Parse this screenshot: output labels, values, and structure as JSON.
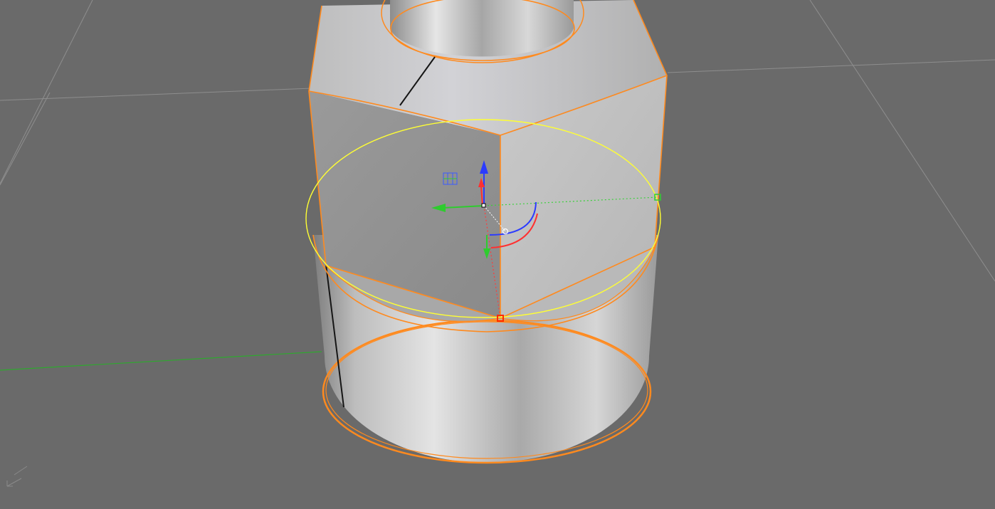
{
  "viewport": {
    "name": "3D viewport",
    "background": "#6a6a6a",
    "grid_color": "#8a8a8a",
    "x_axis_color": "#2fa82f"
  },
  "object": {
    "kind": "hex nut on cylinder",
    "selection_color": "#ff8a1e",
    "surface_light": "#dcdcdc",
    "surface_dark": "#8c8c8c"
  },
  "gizmo": {
    "x_color": "#2ecc2e",
    "y_color": "#ff3030",
    "z_color": "#2b3bff",
    "ring_color": "#ffff33",
    "snap_point_color": "#ff2a00",
    "handle_color": "#33cc33"
  },
  "axis_indicator": {
    "icon": "world-axis-icon"
  }
}
